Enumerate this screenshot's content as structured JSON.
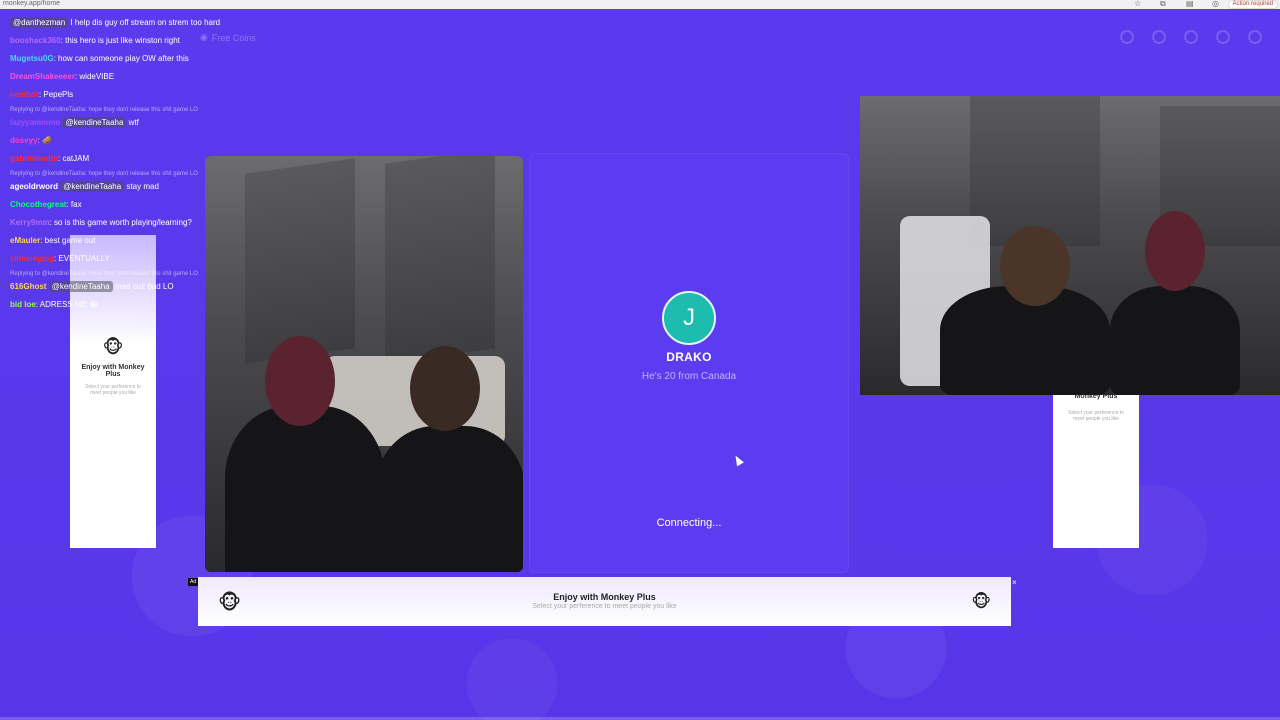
{
  "browser": {
    "url": "monkey.app/home",
    "action_label": "Action required"
  },
  "nav": {
    "free_coins": "Free Coins"
  },
  "chat": [
    {
      "user": "",
      "mention": "@danthezman",
      "text": "I help dis guy off stream on strem too hard",
      "color": "#c84bff"
    },
    {
      "user": "booshack360",
      "mention": "",
      "text": ": this hero is just like winston right",
      "color": "#b06bff"
    },
    {
      "user": "Mugetsu0G",
      "mention": "",
      "text": ": how can someone play OW after this",
      "color": "#4cd6ff"
    },
    {
      "user": "DreamShakeeeer",
      "mention": "",
      "text": ": wideVIBE",
      "color": "#ff4fd8"
    },
    {
      "user": "venibor",
      "mention": "",
      "text": ": PepePls",
      "color": "#ff2a2a"
    },
    {
      "reply": "Replying to @kendineTaaha: hope they dont release this shit game LO"
    },
    {
      "user": "lazyyammmo",
      "mention": "@kendineTaaha",
      "text": "wtf",
      "color": "#a04bff"
    },
    {
      "user": "doseyy",
      "mention": "",
      "text": ": 🥔",
      "color": "#ff3fc8"
    },
    {
      "user": "gabrielmotta",
      "mention": "",
      "text": ": catJAM",
      "color": "#ff2a2a"
    },
    {
      "reply": "Replying to @kendineTaaha: hope they dont release this shit game LO"
    },
    {
      "user": "ageoldrword",
      "mention": "@kendineTaaha",
      "text": "stay mad",
      "color": "#ffffff"
    },
    {
      "user": "Chocothegreat",
      "mention": "",
      "text": ": fax",
      "color": "#00ff7f"
    },
    {
      "user": "Kerry9mm",
      "mention": "",
      "text": ": so is this game worth playing/learning?",
      "color": "#b06bff"
    },
    {
      "user": "eMauler",
      "mention": "",
      "text": ": best game out",
      "color": "#ffd84a"
    },
    {
      "user": "slimeiegpig",
      "mention": "",
      "text": ": EVENTUALLY",
      "color": "#ff2a2a"
    },
    {
      "reply": "Replying to @kendineTaaha: hope they dont release this shit game LO"
    },
    {
      "user": "616Ghost",
      "mention": "@kendineTaaha",
      "text": "mad cuz bad LO",
      "color": "#ffd84a"
    },
    {
      "user": "bid loe",
      "mention": "",
      "text": ": ADRESS ME 😭",
      "color": "#8cff5a"
    }
  ],
  "left_ad": {
    "title": "Enjoy with Monkey Plus",
    "subtitle": "Select your perference to meet people you like"
  },
  "right_ad": {
    "title": "Monkey Plus",
    "subtitle": "Select your perference to meet people you like"
  },
  "match": {
    "avatar_letter": "J",
    "name": "DRAKO",
    "description": "He's 20 from Canada",
    "status": "Connecting..."
  },
  "bottom_ad": {
    "tag": "Ad",
    "title": "Enjoy with Monkey Plus",
    "subtitle": "Select your perference to meet people you like",
    "close": "×"
  },
  "colors": {
    "background": "#5a38ec",
    "avatar": "#1dbcae"
  }
}
